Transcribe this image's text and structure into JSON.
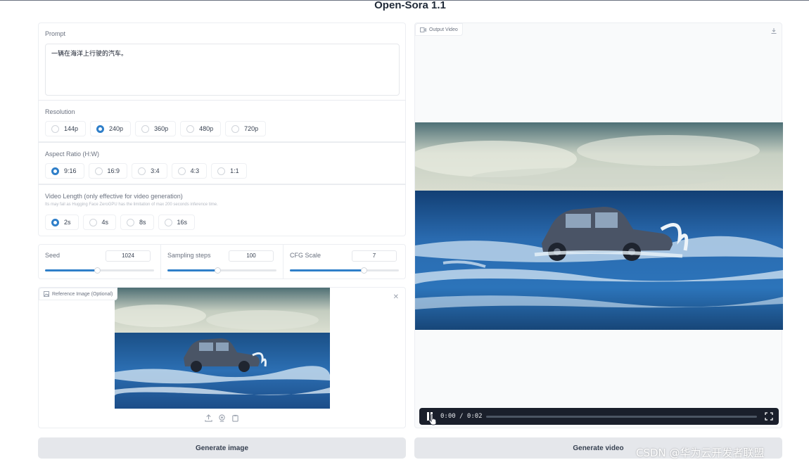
{
  "app": {
    "title": "Open-Sora 1.1"
  },
  "prompt": {
    "label": "Prompt",
    "value": "一辆在海洋上行驶的汽车。"
  },
  "resolution": {
    "label": "Resolution",
    "options": [
      "144p",
      "240p",
      "360p",
      "480p",
      "720p"
    ],
    "selected": "240p"
  },
  "aspect_ratio": {
    "label": "Aspect Ratio (H:W)",
    "options": [
      "9:16",
      "16:9",
      "3:4",
      "4:3",
      "1:1"
    ],
    "selected": "9:16"
  },
  "video_length": {
    "label": "Video Length (only effective for video generation)",
    "hint": "Its may fail as Hugging Face ZeroGPU has the limitation of max 200 seconds inference time.",
    "options": [
      "2s",
      "4s",
      "8s",
      "16s"
    ],
    "selected": "2s"
  },
  "seed": {
    "label": "Seed",
    "value": "1024",
    "fill_fraction": 0.48
  },
  "sampling_steps": {
    "label": "Sampling steps",
    "value": "100",
    "fill_fraction": 0.46
  },
  "cfg_scale": {
    "label": "CFG Scale",
    "value": "7",
    "fill_fraction": 0.68
  },
  "reference_image": {
    "label": "Reference Image (Optional)"
  },
  "output_video": {
    "label": "Output Video",
    "time_display": "0:00 / 0:02",
    "progress_fraction": 0.0
  },
  "buttons": {
    "generate_image": "Generate image",
    "generate_video": "Generate video"
  },
  "watermark": "CSDN @华为云开发者联盟",
  "colors": {
    "accent": "#2f7fc9",
    "button_bg": "#e5e7eb",
    "control_bar": "#1a1f2b"
  }
}
